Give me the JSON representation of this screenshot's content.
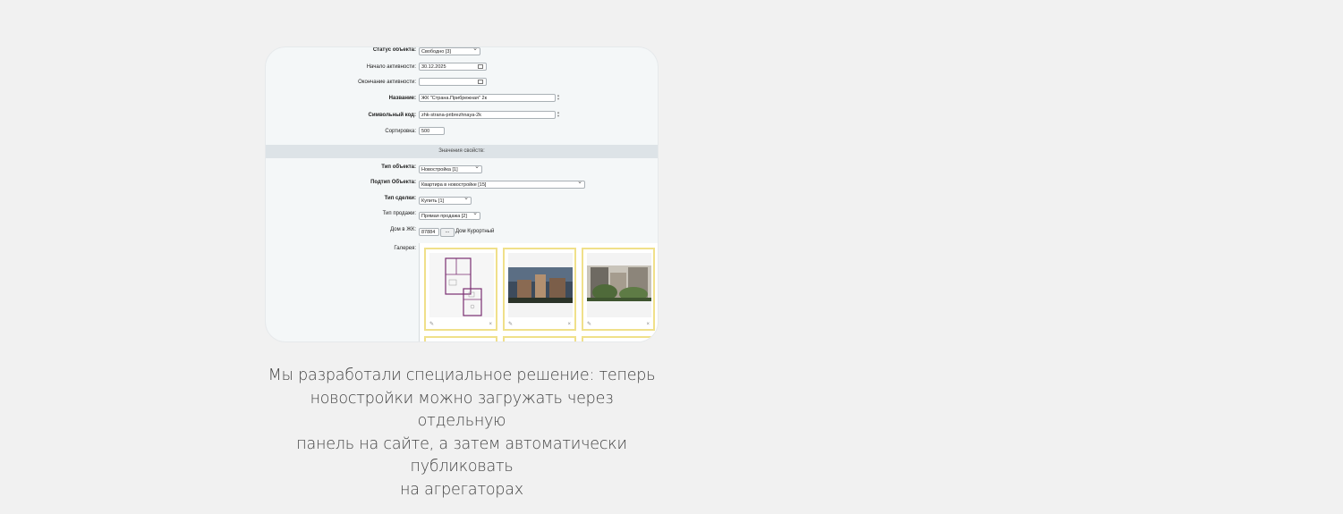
{
  "form": {
    "status_label": "Статус объекта:",
    "status_value": "Свободно [3]",
    "active_from_label": "Начало активности:",
    "active_from_value": "30.12.2025",
    "active_to_label": "Окончание активности:",
    "active_to_value": "",
    "name_label": "Название:",
    "name_value": "ЖК \"Страна.Прибрежная\" 2к",
    "code_label": "Символьный код:",
    "code_value": "zhk-strana-pribrezhnaya-2k",
    "sort_label": "Сортировка:",
    "sort_value": "500",
    "section_title": "Значения свойств:",
    "type_label": "Тип объекта:",
    "type_value": "Новостройка [1]",
    "subtype_label": "Подтип Объекта:",
    "subtype_value": "Квартира в новостройке [15]",
    "deal_label": "Тип сделки:",
    "deal_value": "Купить [1]",
    "sale_label": "Тип продажи:",
    "sale_value": "Прямая продажа [2]",
    "house_label": "Дом в ЖК:",
    "house_value": "87884",
    "house_button": "...",
    "house_name": "Дом Курортный",
    "gallery_label": "Галерея:",
    "edit_icon": "✎",
    "delete_icon": "×"
  },
  "caption": {
    "line1": "Мы разработали специальное решение: теперь",
    "line2": "новостройки можно загружать через отдельную",
    "line3": "панель на сайте, а затем автоматически публиковать",
    "line4": "на агрегаторах"
  },
  "colors": {
    "background": "#f1f1f1",
    "card": "#f4f7f8",
    "tile_border": "#f0e08a",
    "plan_accent": "#7a2e72"
  }
}
